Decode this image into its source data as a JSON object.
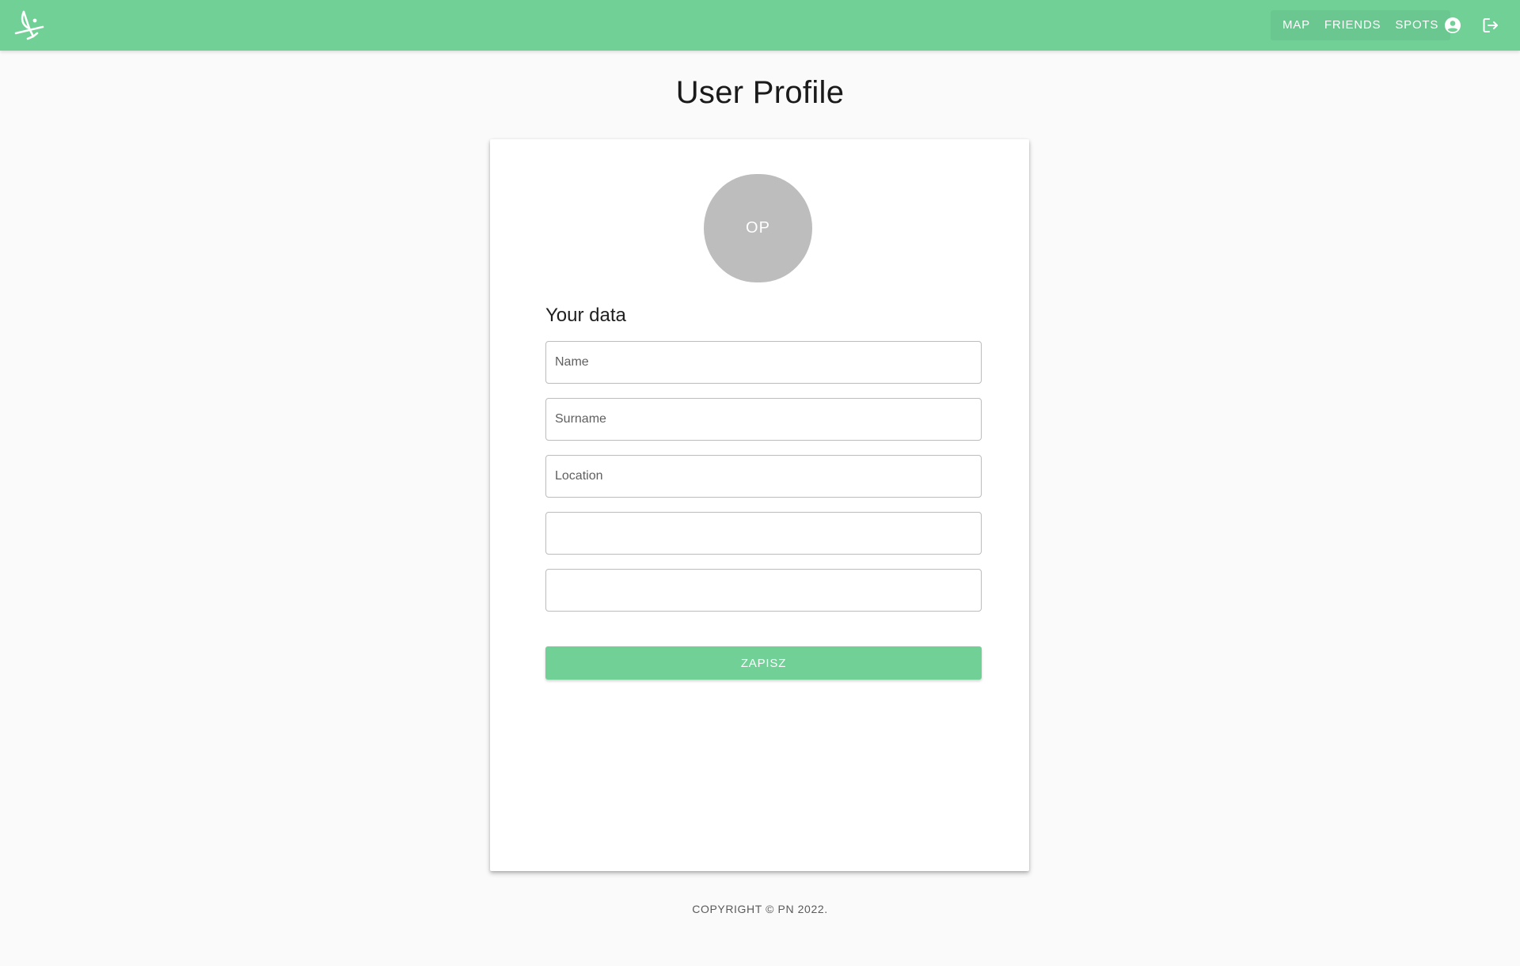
{
  "header": {
    "logo_icon": "windsurfer-logo-icon",
    "accent_color": "#70d096",
    "nav": [
      {
        "label": "MAP"
      },
      {
        "label": "FRIENDS"
      },
      {
        "label": "SPOTS"
      }
    ],
    "profile_icon": "account-circle-icon",
    "logout_icon": "logout-icon"
  },
  "main": {
    "title": "User Profile",
    "avatar_initials": "OP",
    "section_title": "Your data",
    "fields": [
      {
        "placeholder": "Name",
        "value": ""
      },
      {
        "placeholder": "Surname",
        "value": ""
      },
      {
        "placeholder": "Location",
        "value": ""
      },
      {
        "placeholder": "",
        "value": ""
      },
      {
        "placeholder": "",
        "value": ""
      }
    ],
    "save_label": "ZAPISZ"
  },
  "footer": {
    "copyright": "COPYRIGHT © PN 2022."
  }
}
